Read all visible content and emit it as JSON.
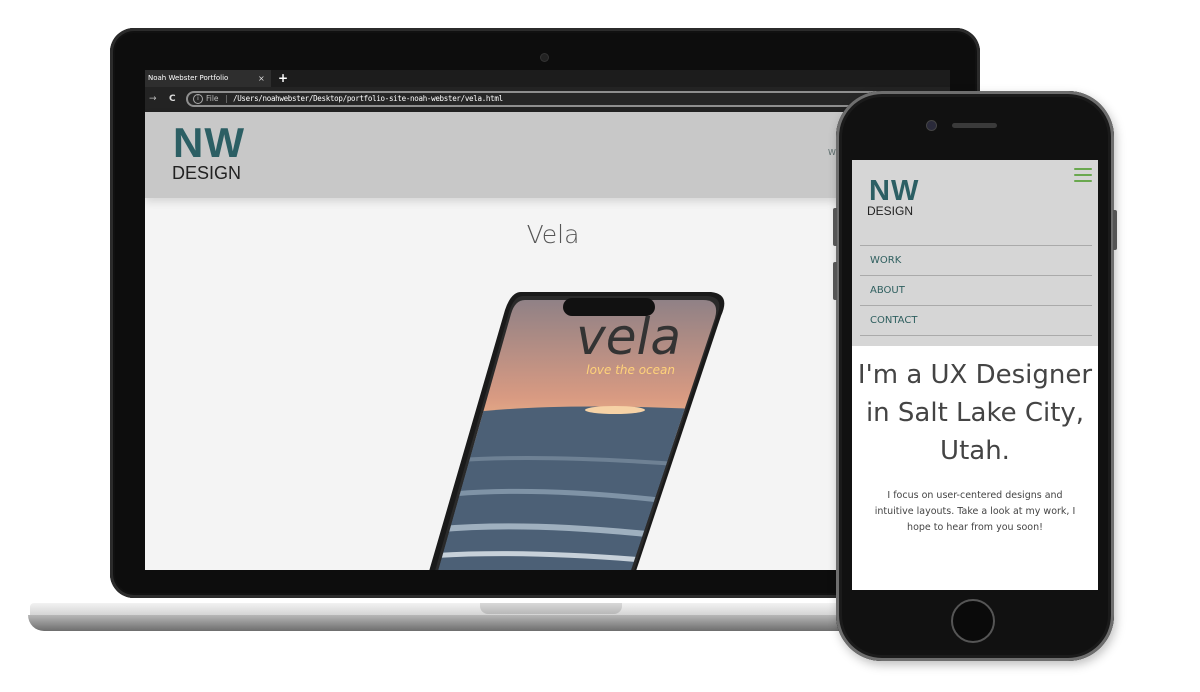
{
  "laptop": {
    "browser": {
      "tab_title": "Noah Webster Portfolio",
      "tab_close": "×",
      "new_tab": "+",
      "back": "→",
      "reload": "C",
      "info_icon_glyph": "i",
      "scheme_label": "File",
      "url": "/Users/noahwebster/Desktop/portfolio-site-noah-webster/vela.html",
      "share_glyph": "⇪"
    },
    "site": {
      "logo_main": "NW",
      "logo_sub": "DESIGN",
      "nav_peek": "W",
      "page_title": "Vela",
      "hero_image": {
        "app_name": "vela",
        "tagline": "love the ocean"
      }
    }
  },
  "phone": {
    "site": {
      "logo_main": "NW",
      "logo_sub": "DESIGN",
      "menu": [
        {
          "label": "WORK"
        },
        {
          "label": "ABOUT"
        },
        {
          "label": "CONTACT"
        }
      ],
      "hero_heading": "I'm a UX Designer in Salt Lake City, Utah.",
      "hero_text": "I focus on user-centered designs and intuitive layouts. Take a look at my work, I hope to hear from you soon!"
    }
  },
  "colors": {
    "logo_teal": "#2c5f64",
    "menu_text": "#2f5f5f",
    "hamburger_green": "#6aa84f",
    "header_gray": "#c8c8c8"
  }
}
